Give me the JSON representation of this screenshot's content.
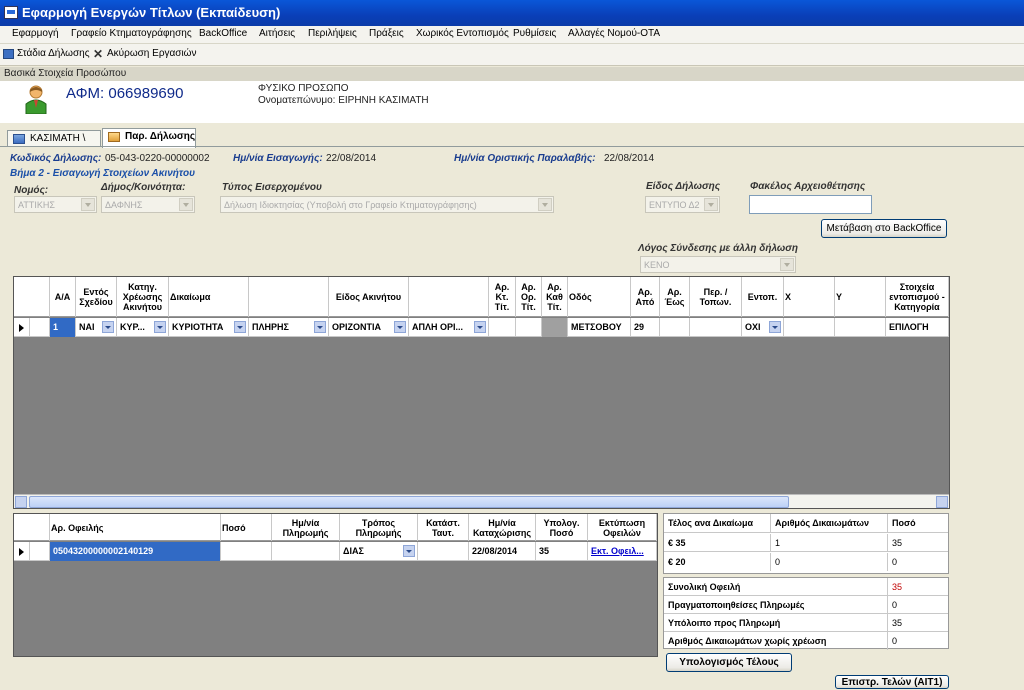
{
  "window": {
    "title": "Εφαρμογή Ενεργών Τίτλων (Εκπαίδευση)"
  },
  "menu": [
    "Εφαρμογή",
    "Γραφείο Κτηματογράφησης",
    "BackOffice",
    "Αιτήσεις",
    "Περιλήψεις",
    "Πράξεις",
    "Χωρικός Εντοπισμός",
    "Ρυθμίσεις",
    "Αλλαγές Νομού-ΟΤΑ"
  ],
  "toolbar": {
    "stages": "Στάδια Δήλωσης",
    "cancel": "Ακύρωση Εργασιών"
  },
  "section": {
    "title": "Βασικά Στοιχεία Προσώπου"
  },
  "person": {
    "afm": "ΑΦΜ: 066989690",
    "type": "ΦΥΣΙΚΟ ΠΡΟΣΩΠΟ",
    "name": "Ονοματεπώνυμο: ΕΙΡΗΝΗ ΚΑΣΙΜΑΤΗ"
  },
  "tabs": [
    "ΚΑΣΙΜΑΤΗ \\",
    "Παρ. Δήλωσης"
  ],
  "declaration": {
    "code_label": "Κωδικός Δήλωσης:",
    "code": "05-043-0220-00000002",
    "entry_label": "Ημ/νία Εισαγωγής:",
    "entry_date": "22/08/2014",
    "receipt_label": "Ημ/νία Οριστικής Παραλαβής:",
    "receipt_date": "22/08/2014"
  },
  "step": "Βήμα 2 - Εισαγωγή Στοιχείων Ακινήτου",
  "form": {
    "nomos_label": "Νομός:",
    "nomos": "ΑΤΤΙΚΗΣ",
    "dimos_label": "Δήμος/Κοινότητα:",
    "dimos": "ΔΑΦΝΗΣ",
    "eiserx_label": "Τύπος Εισερχομένου",
    "eiserx": "Δήλωση Ιδιοκτησίας  (Υποβολή στο Γραφείο Κτηματογράφησης)",
    "eidos_label": "Είδος Δήλωσης",
    "eidos": "ΕΝΤΥΠΟ Δ2",
    "fakelos_label": "Φακέλος Αρχειοθέτησης",
    "fakelos": "",
    "backoffice_btn": "Μετάβαση στο BackOffice",
    "logos_label": "Λόγος Σύνδεσης με άλλη δήλωση",
    "logos": "ΚΕΝΟ"
  },
  "property_grid": {
    "headers": [
      "Α/Α",
      "Εντός Σχεδίου",
      "Κατηγ. Χρέωσης Ακινήτου",
      "Δικαίωμα",
      "",
      "Είδος Ακινήτου",
      "",
      "Αρ. Κτ. Τίτ.",
      "Αρ. Ορ. Τίτ.",
      "Αρ. Καθ Τίτ.",
      "Οδός",
      "Αρ. Από",
      "Αρ. Έως",
      "Περ. / Τοπων.",
      "Εντοπ.",
      "X",
      "Y",
      "Στοιχεία εντοπισμού - Κατηγορία"
    ],
    "rows": [
      [
        "1",
        "ΝΑΙ",
        "ΚΥΡ...",
        "ΚΥΡΙΟΤΗΤΑ",
        "ΠΛΗΡΗΣ",
        "ΟΡΙΖΟΝΤΙΑ",
        "ΑΠΛΗ ΟΡΙ...",
        "",
        "",
        "",
        "ΜΕΤΣΟΒΟΥ",
        "29",
        "",
        "",
        "ΟΧΙ",
        "",
        "",
        "ΕΠΙΛΟΓΗ"
      ]
    ]
  },
  "debt_grid": {
    "headers": [
      "Αρ. Οφειλής",
      "Ποσό",
      "Ημ/νία Πληρωμής",
      "Τρόπος Πληρωμής",
      "Κατάστ. Ταυτ.",
      "Ημ/νία Καταχώρισης",
      "Υπολογ. Ποσό",
      "Εκτύπωση Οφειλών"
    ],
    "rows": [
      [
        "0504320000000214​0129",
        "",
        "",
        "ΔΙΑΣ",
        "",
        "22/08/2014",
        "35",
        "Εκτ. Οφειλ..."
      ]
    ]
  },
  "fees_table": {
    "headers": [
      "Τέλος ανα Δικαίωμα",
      "Αριθμός Δικαιωμάτων",
      "Ποσό"
    ],
    "rows": [
      [
        "€ 35",
        "1",
        "35"
      ],
      [
        "€ 20",
        "0",
        "0"
      ]
    ]
  },
  "summary": [
    {
      "label": "Συνολική Οφειλή",
      "value": "35"
    },
    {
      "label": "Πραγματοποιηθείσες Πληρωμές",
      "value": "0"
    },
    {
      "label": "Υπόλοιπο προς Πληρωμή",
      "value": "35"
    },
    {
      "label": "Αριθμός Δικαιωμάτων χωρίς χρέωση",
      "value": "0"
    }
  ],
  "buttons": {
    "calc": "Υπολογισμός Τέλους",
    "return": "Επιστρ. Τελών (ΑΙΤ1)"
  },
  "colors": {
    "title": "#0a4fd0",
    "accent_label": "#1a3d8f",
    "selection": "#316ac5",
    "link": "#0000cc",
    "total": "#c00000"
  }
}
